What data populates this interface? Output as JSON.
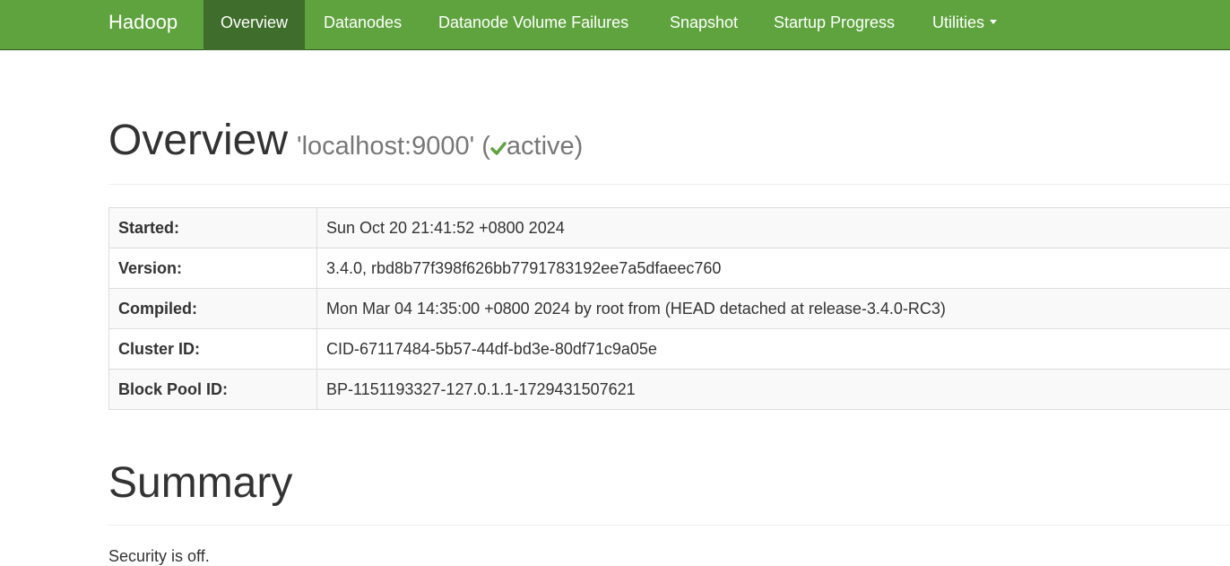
{
  "navbar": {
    "brand": "Hadoop",
    "items": [
      {
        "label": "Overview",
        "active": true
      },
      {
        "label": "Datanodes"
      },
      {
        "label": "Datanode Volume Failures"
      },
      {
        "label": "Snapshot"
      },
      {
        "label": "Startup Progress"
      },
      {
        "label": "Utilities"
      }
    ]
  },
  "overview": {
    "title": "Overview",
    "host": "'localhost:9000'",
    "status_open": "(",
    "status": "active)",
    "status_icon": "check-icon",
    "status_color": "#5fa33e"
  },
  "info": [
    {
      "label": "Started:",
      "value": "Sun Oct 20 21:41:52 +0800 2024"
    },
    {
      "label": "Version:",
      "value": "3.4.0, rbd8b77f398f626bb7791783192ee7a5dfaeec760"
    },
    {
      "label": "Compiled:",
      "value": "Mon Mar 04 14:35:00 +0800 2024 by root from (HEAD detached at release-3.4.0-RC3)"
    },
    {
      "label": "Cluster ID:",
      "value": "CID-67117484-5b57-44df-bd3e-80df71c9a05e"
    },
    {
      "label": "Block Pool ID:",
      "value": "BP-1151193327-127.0.1.1-1729431507621"
    }
  ],
  "summary": {
    "title": "Summary",
    "security": "Security is off."
  },
  "colors": {
    "navbar": "#5fa33e",
    "navbar_active": "#3f6d2c"
  }
}
